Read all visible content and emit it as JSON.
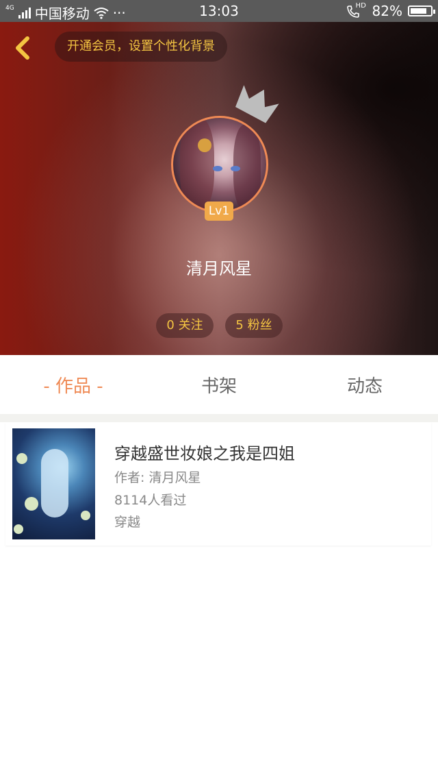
{
  "status_bar": {
    "network_tag": "4G",
    "carrier": "中国移动",
    "dots": "···",
    "time": "13:03",
    "hd_tag": "HD",
    "battery_percent": "82%",
    "battery_level": 0.82
  },
  "header": {
    "vip_prompt": "开通会员，设置个性化背景",
    "level_badge": "Lv1",
    "username": "清月风星",
    "follow_label": "0 关注",
    "fans_label": "5 粉丝"
  },
  "tabs": [
    {
      "label": "- 作品 -",
      "active": true
    },
    {
      "label": "书架",
      "active": false
    },
    {
      "label": "动态",
      "active": false
    }
  ],
  "books": [
    {
      "title": "穿越盛世妆娘之我是四姐",
      "author": "作者: 清月风星",
      "views": "8114人看过",
      "category": "穿越"
    }
  ],
  "colors": {
    "accent": "#ef8a55",
    "gold": "#f4c542",
    "badge": "#f0a94a",
    "tab_inactive": "#666666"
  }
}
